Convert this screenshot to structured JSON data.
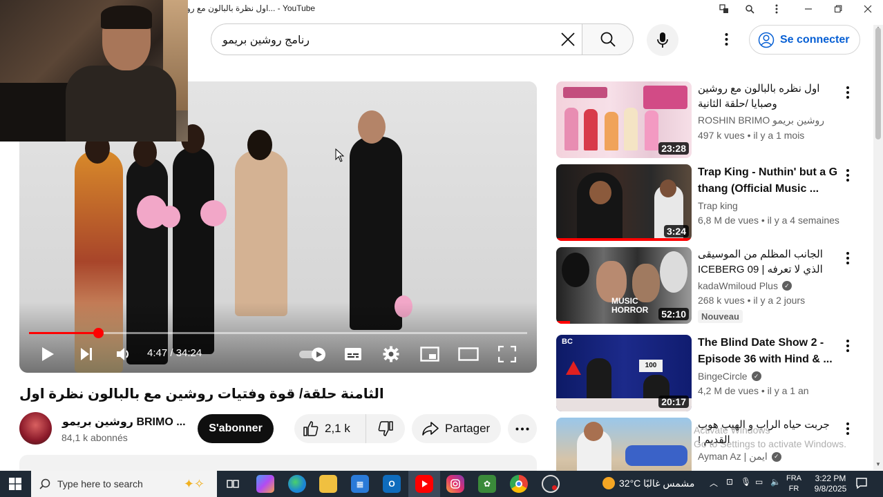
{
  "window": {
    "title": "اول نظرة بالبالون مع رو... - YouTube",
    "controls": [
      "translate-icon",
      "zoom-icon",
      "menu-icon",
      "minimize-icon",
      "restore-icon",
      "close-icon"
    ]
  },
  "header": {
    "search_query": "رنامج روشين بريمو",
    "sign_in_label": "Se connecter"
  },
  "player": {
    "time_current": "4:47",
    "time_total": "34:24",
    "time_label": "4:47 / 34:24",
    "progress_fraction": 0.139,
    "accent_color": "#ff0000"
  },
  "video": {
    "title": "الثامنة حلقة/ قوة وفتيات روشين مع بالبالون نظرة اول",
    "channel_name": "روشين بريمو BRIMO ...",
    "subscribers": "84,1 k abonnés",
    "subscribe_label": "S'abonner",
    "likes": "2,1 k",
    "share_label": "Partager"
  },
  "recommendations": [
    {
      "title": "اول نظره بالبالون مع روشين وصبايا /حلقة الثانية",
      "channel": "ROSHIN BRIMO روشين بريمو",
      "meta": "497 k vues • il y a 1 mois",
      "duration": "23:28",
      "rtl": true,
      "verified": false,
      "badge": ""
    },
    {
      "title": "Trap King - Nuthin' but a G thang (Official Music ...",
      "channel": "Trap king",
      "meta": "6,8 M de vues • il y a 4 semaines",
      "duration": "3:24",
      "rtl": false,
      "verified": false,
      "badge": "",
      "watched": 1
    },
    {
      "title": "الجانب المظلم من الموسيقى الذي لا تعرفه | ICEBERG 09",
      "channel": "kadaWmiloud Plus",
      "meta": "268 k vues • il y a 2 jours",
      "duration": "52:10",
      "rtl": true,
      "verified": true,
      "badge": "Nouveau",
      "watched": 0.1
    },
    {
      "title": "The Blind Date Show 2 - Episode 36 with Hind & ...",
      "channel": "BingeCircle",
      "meta": "4,2 M de vues • il y a 1 an",
      "duration": "20:17",
      "rtl": false,
      "verified": true,
      "badge": ""
    },
    {
      "title": "جربت حياه الراب و الهيب هوب القديم !",
      "channel": "Ayman Az | ايمن",
      "meta": "",
      "duration": "",
      "rtl": true,
      "verified": true,
      "badge": ""
    }
  ],
  "watermark": {
    "line1": "Activate Windows",
    "line2": "Go to Settings to activate Windows."
  },
  "taskbar": {
    "search_placeholder": "Type here to search",
    "weather": "32°C  مشمس غالبًا",
    "lang_top": "FRA",
    "lang_bottom": "FR",
    "time": "3:22 PM",
    "date": "9/8/2025"
  }
}
